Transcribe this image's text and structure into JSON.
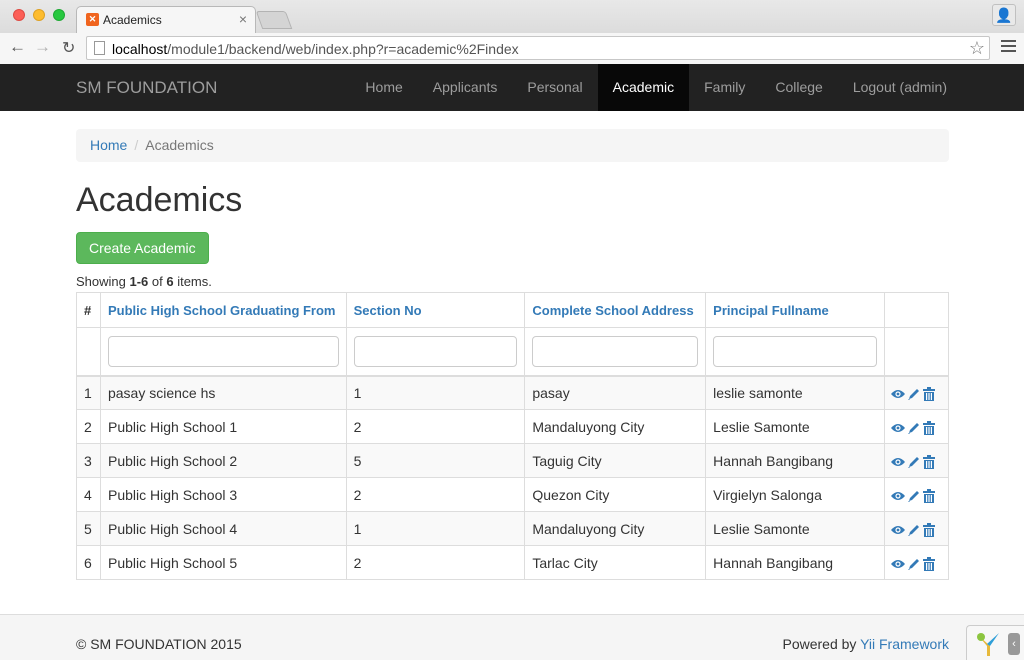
{
  "browser": {
    "tab_title": "Academics",
    "url_host": "localhost",
    "url_path": "/module1/backend/web/index.php?r=academic%2Findex"
  },
  "navbar": {
    "brand": "SM FOUNDATION",
    "items": [
      {
        "label": "Home"
      },
      {
        "label": "Applicants"
      },
      {
        "label": "Personal"
      },
      {
        "label": "Academic"
      },
      {
        "label": "Family"
      },
      {
        "label": "College"
      },
      {
        "label": "Logout (admin)"
      }
    ],
    "active": "Academic"
  },
  "breadcrumb": {
    "home": "Home",
    "current": "Academics"
  },
  "page": {
    "title": "Academics",
    "create_button": "Create Academic",
    "summary_prefix": "Showing ",
    "summary_range": "1-6",
    "summary_of": " of ",
    "summary_total": "6",
    "summary_suffix": " items."
  },
  "table": {
    "columns": [
      "#",
      "Public High School Graduating From",
      "Section No",
      "Complete School Address",
      "Principal Fullname"
    ],
    "rows": [
      [
        "1",
        "pasay science hs",
        "1",
        "pasay",
        "leslie samonte"
      ],
      [
        "2",
        "Public High School 1",
        "2",
        "Mandaluyong City",
        "Leslie Samonte"
      ],
      [
        "3",
        "Public High School 2",
        "5",
        "Taguig City",
        "Hannah Bangibang"
      ],
      [
        "4",
        "Public High School 3",
        "2",
        "Quezon City",
        "Virgielyn Salonga"
      ],
      [
        "5",
        "Public High School 4",
        "1",
        "Mandaluyong City",
        "Leslie Samonte"
      ],
      [
        "6",
        "Public High School 5",
        "2",
        "Tarlac City",
        "Hannah Bangibang"
      ]
    ],
    "action_icons": [
      "eye-icon",
      "pencil-icon",
      "trash-icon"
    ],
    "link_color": "#337ab7"
  },
  "footer": {
    "copyright": "© SM FOUNDATION 2015",
    "powered_by": "Powered by ",
    "framework": "Yii Framework"
  }
}
